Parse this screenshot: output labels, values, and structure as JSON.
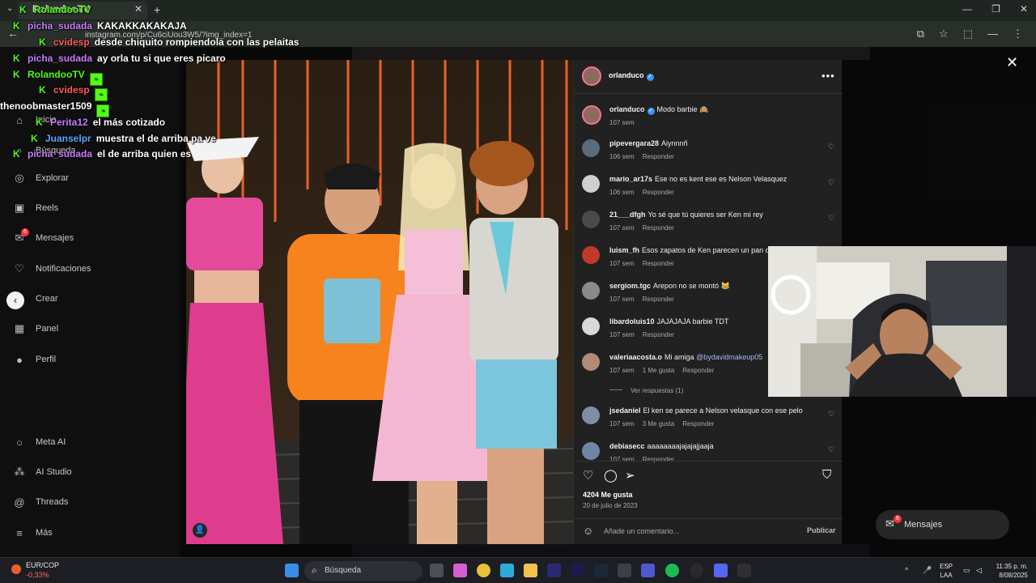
{
  "browser": {
    "tab_title": "RolandooTV",
    "url": "instagram.com/p/Cu6ciUou3W5/?img_index=1"
  },
  "sidebar": {
    "items": [
      {
        "label": "Inicio",
        "icon": "home-icon"
      },
      {
        "label": "Búsqueda",
        "icon": "search-icon"
      },
      {
        "label": "Explorar",
        "icon": "compass-icon"
      },
      {
        "label": "Reels",
        "icon": "reels-icon"
      },
      {
        "label": "Mensajes",
        "icon": "messenger-icon",
        "badge": "6"
      },
      {
        "label": "Notificaciones",
        "icon": "heart-icon"
      },
      {
        "label": "Crear",
        "icon": "plus-icon"
      },
      {
        "label": "Panel",
        "icon": "chart-icon"
      },
      {
        "label": "Perfil",
        "icon": "avatar-icon"
      },
      {
        "label": "Meta AI",
        "icon": "meta-ai-icon"
      },
      {
        "label": "AI Studio",
        "icon": "ai-studio-icon"
      },
      {
        "label": "Threads",
        "icon": "threads-icon"
      },
      {
        "label": "Más",
        "icon": "menu-icon"
      }
    ]
  },
  "chat": [
    {
      "user": "RolandooTV",
      "color": "#53fc18",
      "message": "",
      "badges": 0
    },
    {
      "user": "picha_sudada",
      "color": "#c77dff",
      "message": "KAKAKKAKAKAJA",
      "badges": 0
    },
    {
      "user": "cvidesp",
      "color": "#ff5a5a",
      "message": "desde chiquito rompiendola con las pelaitas",
      "badges": 0
    },
    {
      "user": "picha_sudada",
      "color": "#c77dff",
      "message": "ay orla tu si que eres picaro",
      "badges": 0
    },
    {
      "user": "RolandooTV",
      "color": "#53fc18",
      "message": "",
      "badges": 1
    },
    {
      "user": "cvidesp",
      "color": "#ff5a5a",
      "message": "",
      "badges": 1
    },
    {
      "user": "thenoobmaster1509",
      "color": "#ffffff",
      "message": "",
      "badges": 1
    },
    {
      "user": "Perita12",
      "color": "#c77dff",
      "message": "el más cotizado",
      "badges": 0
    },
    {
      "user": "Juanselpr",
      "color": "#5aa7ff",
      "message": "muestra el de arriba pa ve",
      "badges": 0
    },
    {
      "user": "picha_sudada",
      "color": "#c77dff",
      "message": "el de arriba quien es",
      "badges": 0
    }
  ],
  "post": {
    "author": "orlanduco",
    "caption": "Modo barbie 🙈",
    "caption_time": "107 sem",
    "likes": "4204 Me gusta",
    "date": "20 de julio de 2023",
    "comment_placeholder": "Añade un comentario...",
    "publish_label": "Publicar",
    "view_replies": "Ver respuestas (1)",
    "reply_label": "Responder",
    "comments": [
      {
        "user": "pipevergara28",
        "text": "Aiynnnñ",
        "time": "106 sem",
        "likes": ""
      },
      {
        "user": "mario_ar17s",
        "text": "Ese no es kent ese es Nelson Velasquez",
        "time": "106 sem",
        "likes": ""
      },
      {
        "user": "21___dfgh",
        "text": "Yo sé que tú quieres ser Ken mi rey",
        "time": "107 sem",
        "likes": ""
      },
      {
        "user": "luism_fh",
        "text": "Esos zapatos de Ken parecen un pan de",
        "time": "107 sem",
        "likes": ""
      },
      {
        "user": "sergiom.tgc",
        "text": "Arepon no se montó 😹",
        "time": "107 sem",
        "likes": ""
      },
      {
        "user": "libardoluis10",
        "text": "JAJAJAJA barbie TDT",
        "time": "107 sem",
        "likes": ""
      },
      {
        "user": "valeriaacosta.o",
        "text": "Mi amiga",
        "mention": "@bydavidmakeup05",
        "time": "107 sem",
        "likes": "1 Me gusta"
      },
      {
        "user": "jsedaniel",
        "text": "El ken se parece a Nelson velasque con ese pelo",
        "time": "107 sem",
        "likes": "3 Me gusta"
      },
      {
        "user": "debiasecc",
        "text": "aaaaaaaajajajajjaaja",
        "time": "107 sem",
        "likes": ""
      }
    ]
  },
  "floating_messages": {
    "label": "Mensajes",
    "badge": "6"
  },
  "taskbar": {
    "currency_pair": "EUR/COP",
    "currency_change": "-0,33%",
    "search_label": "Búsqueda",
    "lang_top": "ESP",
    "lang_bottom": "LAA",
    "time": "11:35 p. m.",
    "date": "8/08/2025"
  },
  "colors": {
    "accent_blue": "#3b95f5",
    "kick_green": "#53fc18",
    "notification_red": "#ff3040"
  }
}
